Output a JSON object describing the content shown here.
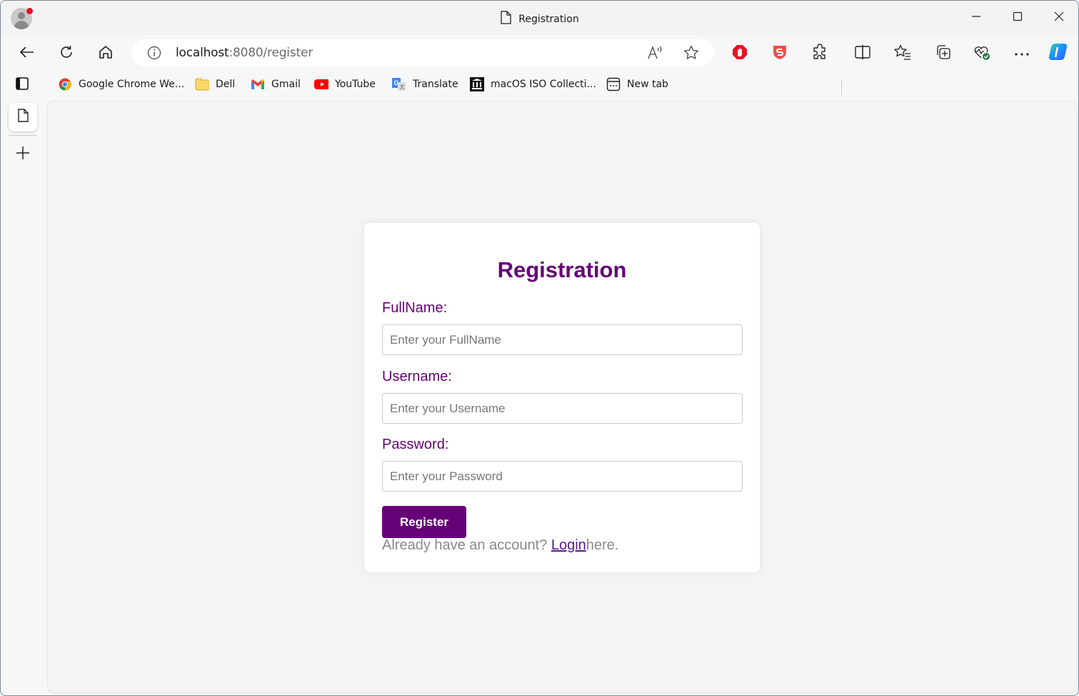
{
  "window": {
    "title": "Registration",
    "controls": {
      "minimize": "minimize-icon",
      "maximize": "maximize-icon",
      "close": "close-icon"
    }
  },
  "toolbar": {
    "url_host": "localhost",
    "url_rest": ":8080/register",
    "icons": [
      "back-icon",
      "refresh-icon",
      "home-icon",
      "site-info-icon",
      "read-aloud-icon",
      "favorite-star-icon",
      "adblock-icon",
      "surfshark-icon",
      "extensions-icon",
      "split-screen-icon",
      "favorites-icon",
      "collections-icon",
      "browser-essentials-icon",
      "more-icon",
      "copilot-icon"
    ]
  },
  "bookmarks": [
    {
      "label": "Google Chrome We...",
      "icon": "chrome-icon"
    },
    {
      "label": "Dell",
      "icon": "folder-icon"
    },
    {
      "label": "Gmail",
      "icon": "gmail-icon"
    },
    {
      "label": "YouTube",
      "icon": "youtube-icon"
    },
    {
      "label": "Translate",
      "icon": "translate-icon"
    },
    {
      "label": "macOS ISO Collecti...",
      "icon": "archive-icon"
    },
    {
      "label": "New tab",
      "icon": "new-tab-icon"
    }
  ],
  "form": {
    "heading": "Registration",
    "fields": [
      {
        "label": "FullName:",
        "placeholder": "Enter your FullName",
        "value": ""
      },
      {
        "label": "Username:",
        "placeholder": "Enter your Username",
        "value": ""
      },
      {
        "label": "Password:",
        "placeholder": "Enter your Password",
        "value": ""
      }
    ],
    "submit_label": "Register",
    "footer_prefix": "Already have an account? ",
    "footer_link": "Login",
    "footer_suffix": "here."
  },
  "colors": {
    "accent": "#660077",
    "link": "#551a8b",
    "muted_text": "#888888",
    "page_bg": "#f4f4f4"
  }
}
